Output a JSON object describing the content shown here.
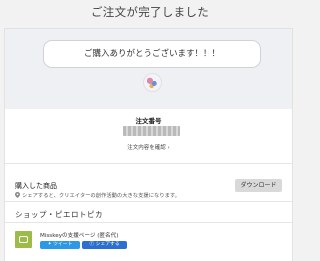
{
  "header": {
    "title": "ご注文が完了しました"
  },
  "thanks": {
    "message": "ご購入ありがとうございます！！！"
  },
  "order": {
    "label": "注文番号",
    "link_label": "注文内容を確認 ›"
  },
  "purchased": {
    "title": "購入した商品",
    "note": "シェアすると、クリエイターの創作活動の大きな支援になります。",
    "download_label": "ダウンロード"
  },
  "shop": {
    "name": "ショップ・ピエロトピカ"
  },
  "item": {
    "title": "Misskeyの支援ページ (匿名代)",
    "tweet_label": "ツイート",
    "share_label": "シェアする"
  },
  "colors": {
    "twitter": "#2c98e6",
    "facebook": "#2d6fd0",
    "thumb": "#9dbb48"
  }
}
